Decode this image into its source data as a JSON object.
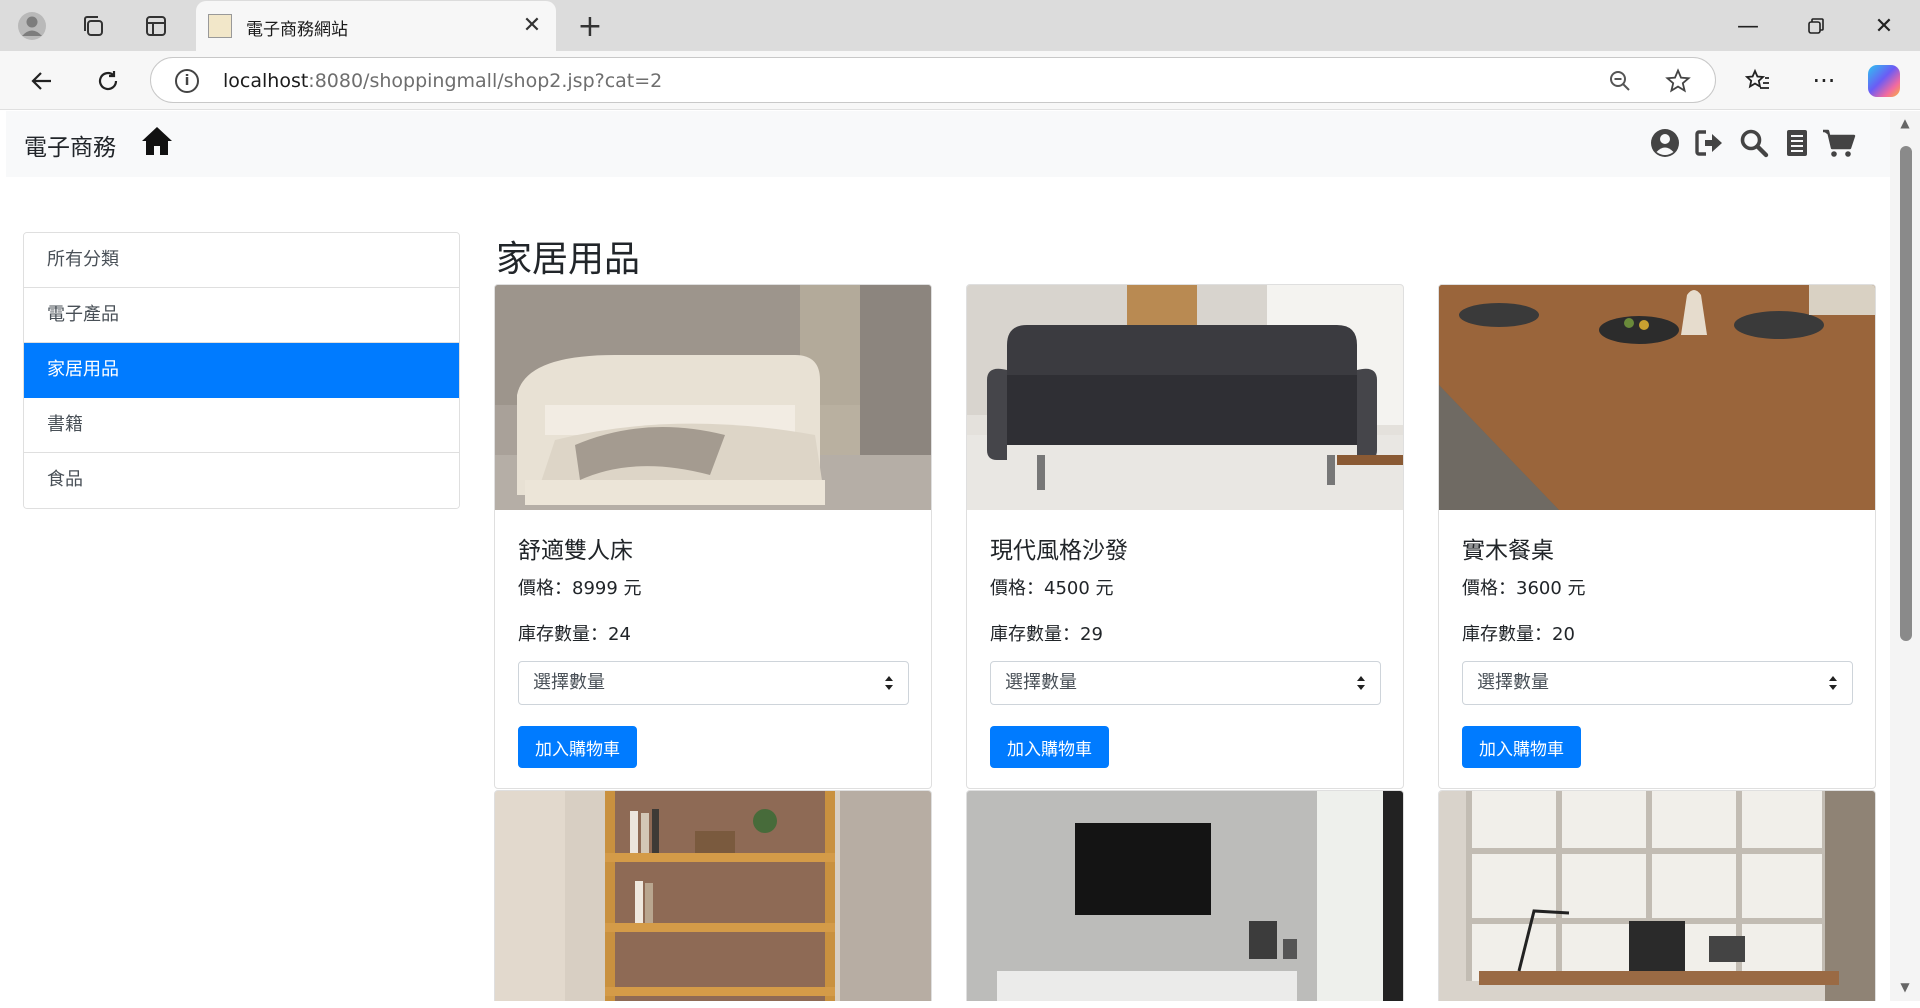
{
  "browser": {
    "tab_title": "電子商務網站",
    "url_host": "localhost",
    "url_rest": ":8080/shoppingmall/shop2.jsp?cat=2"
  },
  "navbar": {
    "brand": "電子商務"
  },
  "sidebar": {
    "items": [
      {
        "label": "所有分類",
        "active": false
      },
      {
        "label": "電子產品",
        "active": false
      },
      {
        "label": "家居用品",
        "active": true
      },
      {
        "label": "書籍",
        "active": false
      },
      {
        "label": "食品",
        "active": false
      }
    ]
  },
  "main": {
    "title": "家居用品",
    "products": [
      {
        "name": "舒適雙人床",
        "price": "價格：8999 元",
        "stock": "庫存數量：24",
        "select_placeholder": "選擇數量",
        "button": "加入購物車"
      },
      {
        "name": "現代風格沙發",
        "price": "價格：4500 元",
        "stock": "庫存數量：29",
        "select_placeholder": "選擇數量",
        "button": "加入購物車"
      },
      {
        "name": "實木餐桌",
        "price": "價格：3600 元",
        "stock": "庫存數量：20",
        "select_placeholder": "選擇數量",
        "button": "加入購物車"
      }
    ]
  },
  "colors": {
    "primary": "#007bff",
    "navbar_bg": "#f8f9fa"
  }
}
